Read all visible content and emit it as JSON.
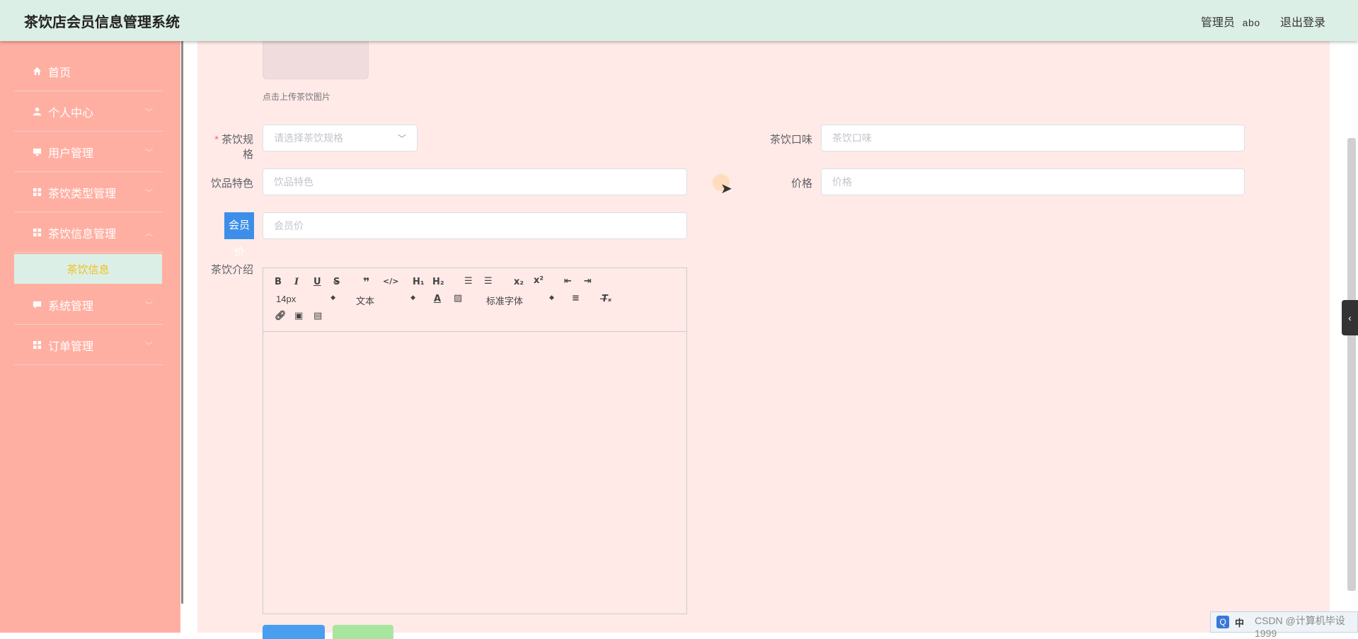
{
  "app": {
    "title": "茶饮店会员信息管理系统"
  },
  "header": {
    "role": "管理员",
    "username": "abo",
    "logout": "退出登录"
  },
  "sidebar": {
    "items": [
      {
        "label": "首页",
        "icon": "home-icon"
      },
      {
        "label": "个人中心",
        "icon": "user-icon"
      },
      {
        "label": "用户管理",
        "icon": "monitor-icon"
      },
      {
        "label": "茶饮类型管理",
        "icon": "grid-icon"
      },
      {
        "label": "茶饮信息管理",
        "icon": "grid-icon"
      },
      {
        "label": "系统管理",
        "icon": "chat-icon"
      },
      {
        "label": "订单管理",
        "icon": "grid-icon"
      }
    ],
    "active_sub": "茶饮信息"
  },
  "form": {
    "upload_hint": "点击上传茶饮图片",
    "spec": {
      "label": "茶饮规格",
      "placeholder": "请选择茶饮规格"
    },
    "taste": {
      "label": "茶饮口味",
      "placeholder": "茶饮口味"
    },
    "feature": {
      "label": "饮品特色",
      "placeholder": "饮品特色"
    },
    "price": {
      "label": "价格",
      "placeholder": "价格"
    },
    "member_price": {
      "label": "会员价",
      "placeholder": "会员价"
    },
    "intro": {
      "label": "茶饮介绍"
    }
  },
  "editor": {
    "font_size": "14px",
    "block_type": "文本",
    "font_family": "标准字体"
  },
  "taskbar": {
    "ime": "中",
    "watermark": "CSDN @计算机毕设1999"
  }
}
